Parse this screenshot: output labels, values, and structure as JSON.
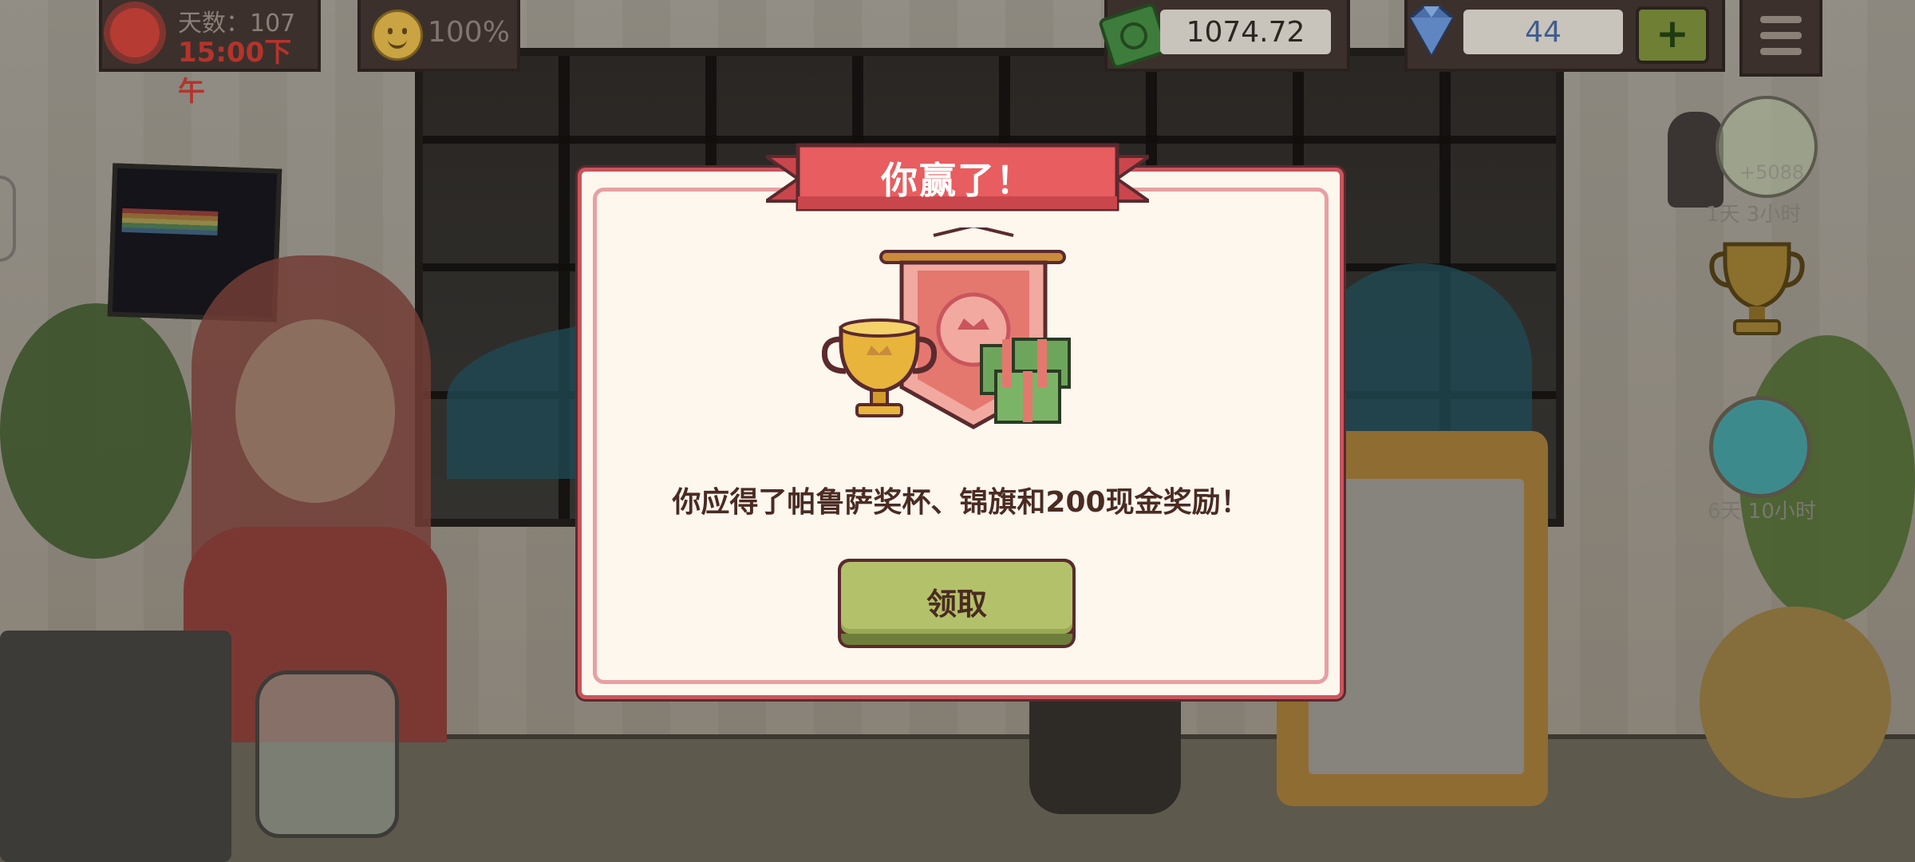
{
  "hud": {
    "days_label": "天数：107",
    "days_time": "15:00下午",
    "happiness": "100%",
    "cash": "1074.72",
    "gems": "44",
    "plus_label": "+"
  },
  "side_widgets": {
    "jar_bonus": "+5088",
    "jar_timer": "1天 3小时",
    "globe_timer": "6天 10小时"
  },
  "modal": {
    "title": "你赢了！",
    "message": "你应得了帕鲁萨奖杯、锦旗和200现金奖励！",
    "claim_label": "领取"
  },
  "colors": {
    "ribbon": "#e85d5f",
    "modal_border": "#c9555d",
    "button": "#b3c26a",
    "text_dark": "#4a2b22"
  },
  "icons": [
    "sun-icon",
    "smile-icon",
    "cash-icon",
    "gem-icon",
    "menu-icon",
    "trophy-icon",
    "pennant-icon",
    "money-stack-icon"
  ]
}
